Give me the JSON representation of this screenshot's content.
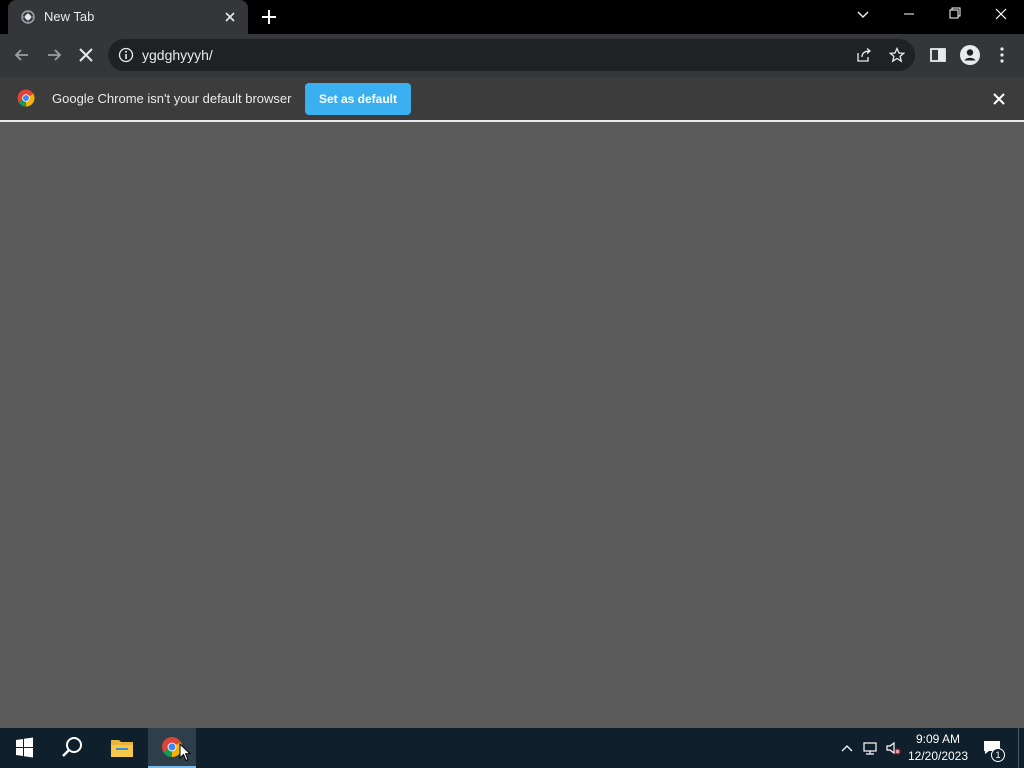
{
  "browser": {
    "tab": {
      "title": "New Tab",
      "favicon": "loading-globe-icon"
    },
    "window_controls": [
      "tab-search-icon",
      "minimize-icon",
      "restore-icon",
      "close-icon"
    ],
    "toolbar": {
      "url": "ygdghyyyh/",
      "icons": [
        "back-arrow-icon",
        "forward-arrow-icon",
        "stop-loading-icon",
        "site-info-icon",
        "share-icon",
        "bookmark-star-icon",
        "side-panel-icon",
        "profile-icon",
        "kebab-menu-icon"
      ]
    },
    "infobar": {
      "message": "Google Chrome isn't your default browser",
      "button_label": "Set as default",
      "accent": "#3bb0f1"
    }
  },
  "taskbar": {
    "apps": [
      "windows-start-icon",
      "search-icon",
      "file-explorer-icon",
      "chrome-icon"
    ],
    "tray": {
      "time": "9:09 AM",
      "date": "12/20/2023",
      "notification_count": "1",
      "icons": [
        "chevron-up-icon",
        "network-icon",
        "volume-muted-icon",
        "action-center-icon"
      ]
    }
  }
}
